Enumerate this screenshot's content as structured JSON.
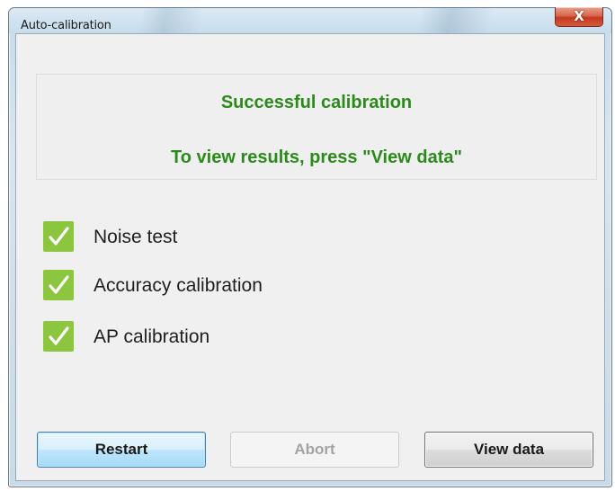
{
  "window": {
    "title": "Auto-calibration",
    "close_glyph": "X"
  },
  "status": {
    "line1": "Successful calibration",
    "line2": "To view results, press \"View data\"",
    "color": "#2c8a1c"
  },
  "checks": [
    {
      "label": "Noise test",
      "checked": true,
      "icon": "checkmark-icon"
    },
    {
      "label": "Accuracy calibration",
      "checked": true,
      "icon": "checkmark-icon"
    },
    {
      "label": "AP calibration",
      "checked": true,
      "icon": "checkmark-icon"
    }
  ],
  "buttons": {
    "restart": "Restart",
    "abort": "Abort",
    "view_data": "View data"
  },
  "colors": {
    "check_fill": "#8cc63f",
    "status_text": "#2c8a1c",
    "close_button": "#c4381e"
  }
}
